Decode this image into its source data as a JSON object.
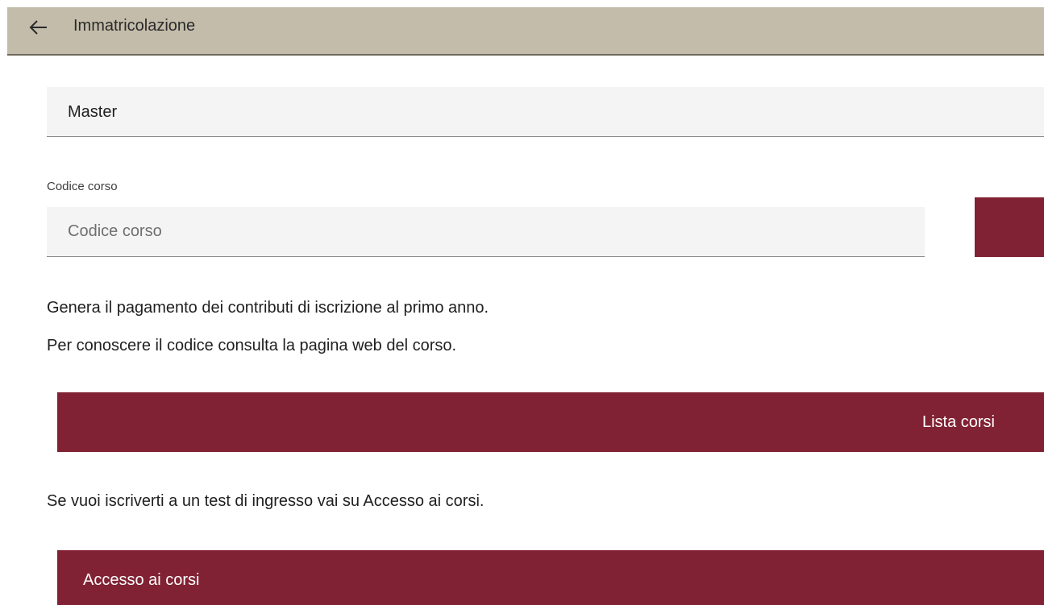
{
  "header": {
    "back_icon": "arrow-left-icon",
    "title": "Immatricolazione"
  },
  "course_type_select": {
    "value": "Master"
  },
  "course_code": {
    "label": "Codice corso",
    "placeholder": "Codice corso",
    "value": ""
  },
  "info": {
    "line1": "Genera il pagamento dei contributi di iscrizione al primo anno.",
    "line2": "Per conoscere il codice consulta la pagina web del corso."
  },
  "list_button": {
    "label": "Lista corsi"
  },
  "access": {
    "text": "Se vuoi iscriverti a un test di ingresso vai su Accesso ai corsi.",
    "button_label": "Accesso ai corsi"
  },
  "colors": {
    "header_bg": "#c3bcaa",
    "accent": "#812234",
    "field_bg": "#f4f4f4"
  }
}
